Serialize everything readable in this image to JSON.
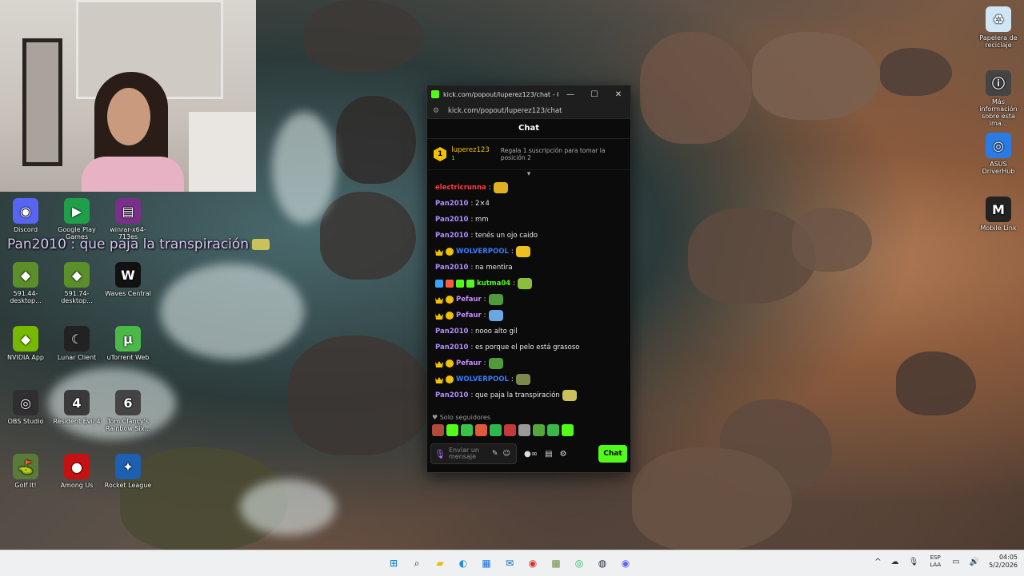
{
  "overlay": {
    "text": "Pan2010 : que paja la transpiración"
  },
  "desktop": {
    "left_icons": [
      {
        "label": "Discord",
        "icon": "discord-icon",
        "color": "#5865f2",
        "glyph": "◉"
      },
      {
        "label": "Google Play Games",
        "icon": "google-play-games-icon",
        "color": "#1f9f4a",
        "glyph": "▶"
      },
      {
        "label": "winrar-x64-713es",
        "icon": "winrar-icon",
        "color": "#7a2f8a",
        "glyph": "▤"
      },
      {
        "label": "591.44-desktop...",
        "icon": "nvidia-installer-icon",
        "color": "#5a8f2a",
        "glyph": "◆"
      },
      {
        "label": "591.74-desktop...",
        "icon": "nvidia-installer-icon",
        "color": "#5a8f2a",
        "glyph": "◆"
      },
      {
        "label": "Waves Central",
        "icon": "waves-central-icon",
        "color": "#111111",
        "glyph": "W"
      },
      {
        "label": "NVIDIA App",
        "icon": "nvidia-app-icon",
        "color": "#76b900",
        "glyph": "◆"
      },
      {
        "label": "Lunar Client",
        "icon": "lunar-client-icon",
        "color": "#222222",
        "glyph": "☾"
      },
      {
        "label": "uTorrent Web",
        "icon": "utorrent-icon",
        "color": "#4cb848",
        "glyph": "µ"
      },
      {
        "label": "OBS Studio",
        "icon": "obs-studio-icon",
        "color": "#302e31",
        "glyph": "◎"
      },
      {
        "label": "Resident Evil 4",
        "icon": "resident-evil-4-icon",
        "color": "#3a3a3a",
        "glyph": "4"
      },
      {
        "label": "Tom Clancy's Rainbow Six...",
        "icon": "rainbow-six-icon",
        "color": "#444444",
        "glyph": "6"
      },
      {
        "label": "Golf It!",
        "icon": "golf-it-icon",
        "color": "#5a7a3a",
        "glyph": "⛳"
      },
      {
        "label": "Among Us",
        "icon": "among-us-icon",
        "color": "#c51111",
        "glyph": "●"
      },
      {
        "label": "Rocket League",
        "icon": "rocket-league-icon",
        "color": "#1d5fb0",
        "glyph": "✦"
      }
    ],
    "right_icons": [
      {
        "label": "Papelera de reciclaje",
        "icon": "recycle-bin-icon"
      },
      {
        "label": "Más información sobre esta ima...",
        "icon": "info-spotlight-icon"
      },
      {
        "label": "ASUS DriverHub",
        "icon": "asus-driverhub-icon"
      },
      {
        "label": "Mobile Link",
        "icon": "mobile-link-icon"
      }
    ]
  },
  "chat_window": {
    "title": "kick.com/popout/luperez123/chat - Go...",
    "url": "kick.com/popout/luperez123/chat",
    "header": "Chat",
    "pinned": {
      "user": "luperez123",
      "count": "1",
      "rank": "1",
      "gift_text": "Regala 1 suscripción para tomar la posición 2"
    },
    "messages": [
      {
        "user": "electricrunna",
        "color": "#ff3b3b",
        "text": ":",
        "emote": "#e0b020",
        "badges": []
      },
      {
        "user": "Pan2010",
        "color": "#b48cff",
        "text": ": 2×4",
        "badges": []
      },
      {
        "user": "Pan2010",
        "color": "#b48cff",
        "text": ": mm",
        "badges": []
      },
      {
        "user": "Pan2010",
        "color": "#b48cff",
        "text": ": tenés un ojo caido",
        "badges": []
      },
      {
        "user": "WOLVERPOOL",
        "color": "#3a7bff",
        "text": ":",
        "emote": "#f0c020",
        "badges": [
          "crown",
          "sub"
        ]
      },
      {
        "user": "Pan2010",
        "color": "#b48cff",
        "text": ": na mentira",
        "badges": []
      },
      {
        "user": "kutma04",
        "color": "#53fc18",
        "text": ":",
        "emote": "#8bbf3a",
        "badges": [
          "blue",
          "red",
          "green",
          "green"
        ]
      },
      {
        "user": "Pefaur",
        "color": "#c58cff",
        "text": ":",
        "emote": "#4f9a3a",
        "badges": [
          "crown",
          "sub"
        ]
      },
      {
        "user": "Pefaur",
        "color": "#c58cff",
        "text": ":",
        "emote": "#6aa6e0",
        "badges": [
          "crown",
          "sub"
        ]
      },
      {
        "user": "Pan2010",
        "color": "#b48cff",
        "text": ": nooo alto gil",
        "badges": []
      },
      {
        "user": "Pan2010",
        "color": "#b48cff",
        "text": ": es porque el pelo está grasoso",
        "badges": []
      },
      {
        "user": "Pefaur",
        "color": "#c58cff",
        "text": ":",
        "emote": "#4f9a3a",
        "badges": [
          "crown",
          "sub"
        ]
      },
      {
        "user": "WOLVERPOOL",
        "color": "#3a7bff",
        "text": ":",
        "emote": "#7a8a4a",
        "badges": [
          "crown",
          "sub"
        ]
      },
      {
        "user": "Pan2010",
        "color": "#b48cff",
        "text": ": que paja la transpiración",
        "emote": "#c9c25a",
        "badges": []
      }
    ],
    "followers_label": "Solo seguidores",
    "emotes": [
      "#b04a3a",
      "#53fc18",
      "#3ac14a",
      "#e05a3a",
      "#2fb84a",
      "#c43a3a",
      "#9a9a9a",
      "#53a83a",
      "#3ab84a",
      "#53fc18"
    ],
    "input_placeholder": "Enviar un mensaje",
    "send_label": "Chat"
  },
  "taskbar": {
    "apps": [
      {
        "name": "start-icon",
        "glyph": "⊞",
        "color": "#0078d4"
      },
      {
        "name": "search-icon",
        "glyph": "⌕",
        "color": "#222222"
      },
      {
        "name": "file-explorer-icon",
        "glyph": "▰",
        "color": "#f2b600"
      },
      {
        "name": "edge-icon",
        "glyph": "◐",
        "color": "#1c8ad8"
      },
      {
        "name": "store-icon",
        "glyph": "▦",
        "color": "#1a73d9"
      },
      {
        "name": "outlook-icon",
        "glyph": "✉",
        "color": "#0a64c2"
      },
      {
        "name": "chrome-icon",
        "glyph": "◉",
        "color": "#d93025"
      },
      {
        "name": "minecraft-icon",
        "glyph": "▩",
        "color": "#6a8f3a"
      },
      {
        "name": "spotify-icon",
        "glyph": "◎",
        "color": "#1db954"
      },
      {
        "name": "steam-icon",
        "glyph": "◍",
        "color": "#1b2838"
      },
      {
        "name": "discord-icon",
        "glyph": "◉",
        "color": "#5865f2"
      }
    ],
    "lang_top": "ESP",
    "lang_bottom": "LAA",
    "time": "04:05",
    "date": "5/2/2026"
  }
}
